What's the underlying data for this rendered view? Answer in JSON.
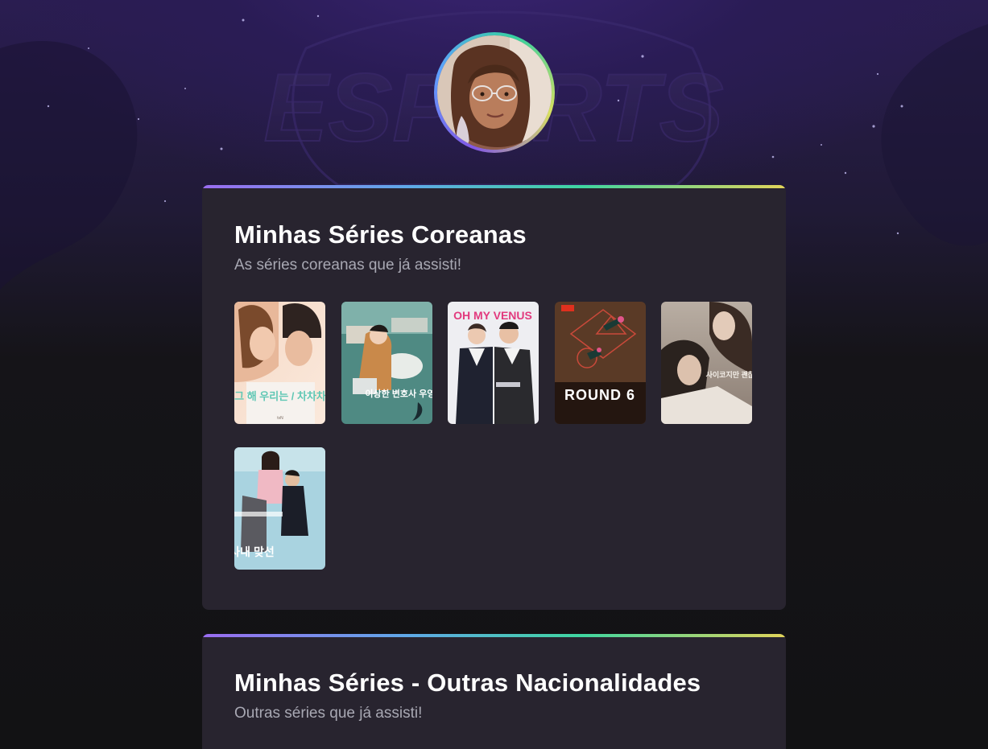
{
  "profile": {
    "avatar_alt": "Foto de perfil"
  },
  "background": {
    "logo_text": "ESPORTS"
  },
  "sections": [
    {
      "title": "Minhas Séries Coreanas",
      "subtitle": "As séries coreanas que já assisti!",
      "posters": [
        {
          "name": "poster-1",
          "caption": "그 해 우리는 / 차차차",
          "kind": "romance-pink"
        },
        {
          "name": "poster-2",
          "caption": "이상한 변호사 우영우",
          "kind": "office-green"
        },
        {
          "name": "poster-3",
          "caption": "OH MY VENUS",
          "kind": "venus"
        },
        {
          "name": "poster-4",
          "caption": "ROUND 6",
          "kind": "round6"
        },
        {
          "name": "poster-5",
          "caption": "사이코지만 괜찮아",
          "kind": "psycho"
        },
        {
          "name": "poster-6",
          "caption": "사내 맞선",
          "kind": "business"
        }
      ]
    },
    {
      "title": "Minhas Séries - Outras Nacionalidades",
      "subtitle": "Outras séries que já assisti!",
      "posters": []
    }
  ],
  "colors": {
    "card_bg": "#28242f",
    "accent_start": "#9a6cf0",
    "accent_mid": "#3fd6a0",
    "accent_end": "#e2d45a",
    "title": "#ffffff",
    "subtitle": "#a8a8b3"
  }
}
